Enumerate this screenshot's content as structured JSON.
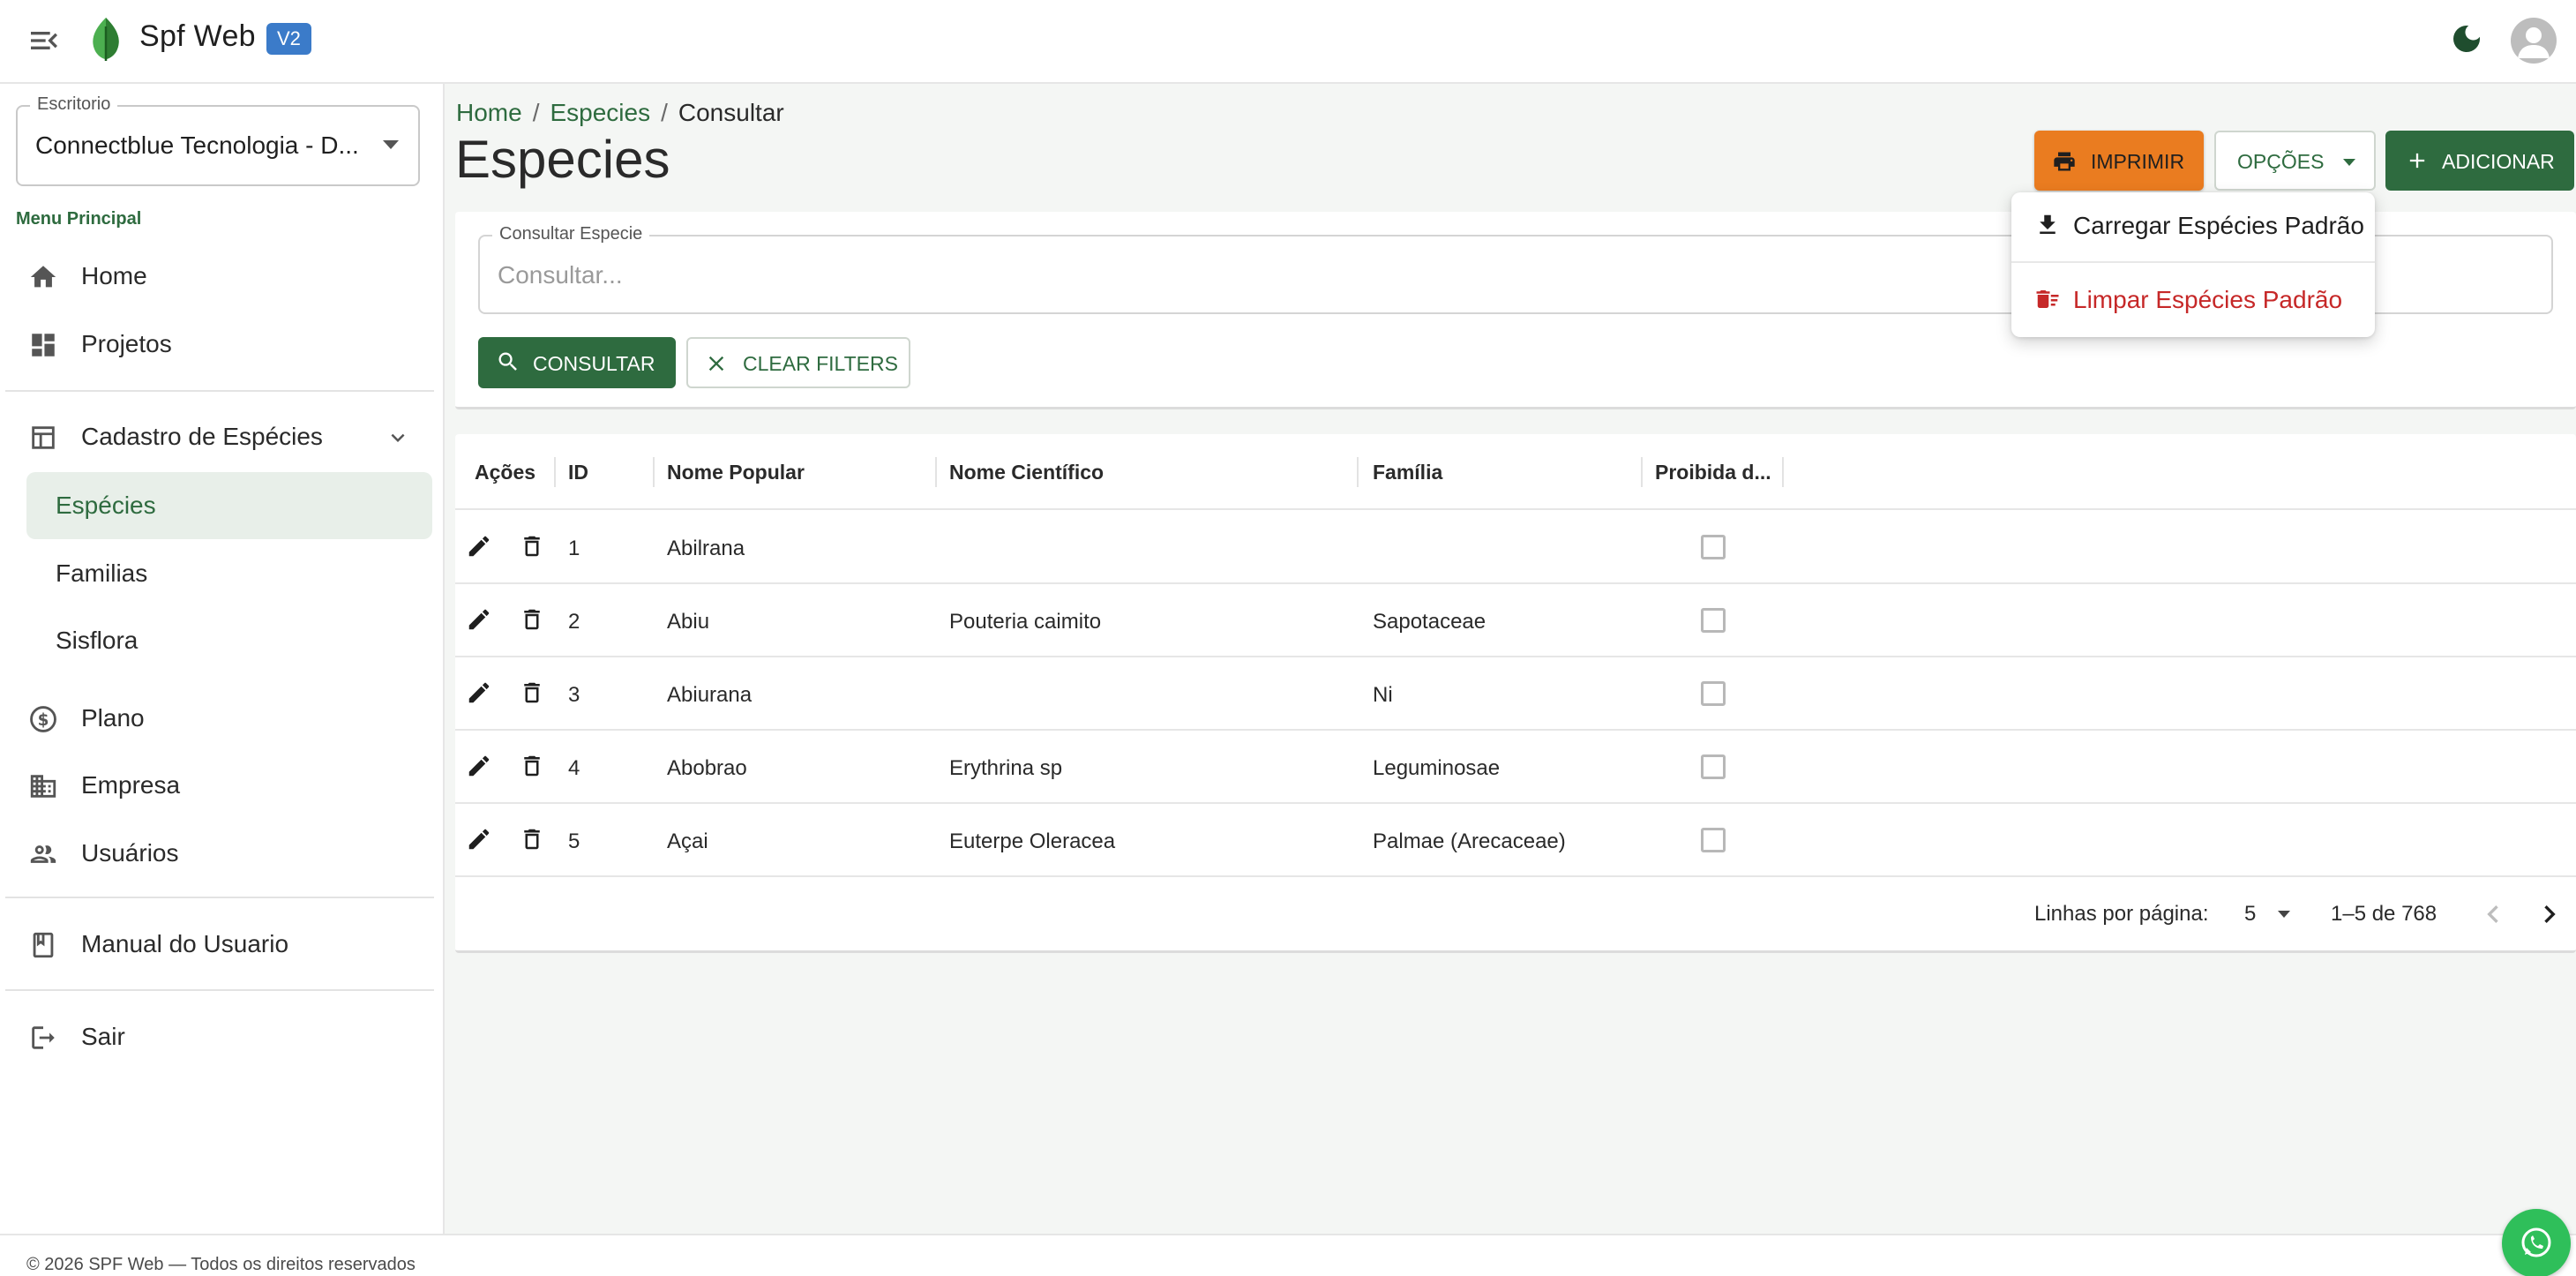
{
  "app": {
    "title": "Spf Web",
    "version": "V2",
    "colors": {
      "primary": "#2e6b3f",
      "accent": "#ea7c20",
      "danger": "#c62828",
      "badge": "#3b7bc9"
    }
  },
  "sidebar": {
    "office": {
      "label": "Escritorio",
      "value": "Connectblue Tecnologia - D..."
    },
    "menu_heading": "Menu Principal",
    "items": {
      "home": "Home",
      "projetos": "Projetos",
      "cadastro": "Cadastro de Espécies",
      "especies": "Espécies",
      "familias": "Familias",
      "sisflora": "Sisflora",
      "plano": "Plano",
      "empresa": "Empresa",
      "usuarios": "Usuários",
      "manual": "Manual do Usuario",
      "sair": "Sair"
    }
  },
  "breadcrumb": {
    "home": "Home",
    "especies": "Especies",
    "current": "Consultar",
    "separator": "/"
  },
  "page": {
    "title": "Especies"
  },
  "actions": {
    "print": "IMPRIMIR",
    "options": "OPÇÕES",
    "add": "ADICIONAR"
  },
  "options_menu": {
    "load_default": "Carregar Espécies Padrão",
    "clear_default": "Limpar Espécies Padrão"
  },
  "filter": {
    "label": "Consultar Especie",
    "placeholder": "Consultar...",
    "value": "",
    "search_button": "CONSULTAR",
    "clear_button": "CLEAR FILTERS"
  },
  "table": {
    "columns": {
      "actions": "Ações",
      "id": "ID",
      "popular": "Nome Popular",
      "scientific": "Nome Científico",
      "family": "Família",
      "forbidden": "Proibida d..."
    },
    "rows": [
      {
        "id": "1",
        "popular": "Abilrana",
        "scientific": "",
        "family": "",
        "forbidden": false
      },
      {
        "id": "2",
        "popular": "Abiu",
        "scientific": "Pouteria caimito",
        "family": "Sapotaceae",
        "forbidden": false
      },
      {
        "id": "3",
        "popular": "Abiurana",
        "scientific": "",
        "family": "Ni",
        "forbidden": false
      },
      {
        "id": "4",
        "popular": "Abobrao",
        "scientific": "Erythrina sp",
        "family": "Leguminosae",
        "forbidden": false
      },
      {
        "id": "5",
        "popular": "Açai",
        "scientific": "Euterpe Oleracea",
        "family": "Palmae (Arecaceae)",
        "forbidden": false
      }
    ],
    "pagination": {
      "rows_label": "Linhas por página:",
      "rows_per_page": "5",
      "range": "1–5 de 768"
    }
  },
  "footer": {
    "text": "© 2026 SPF Web — Todos os direitos reservados"
  },
  "icons": {
    "menu_toggle": "menu-open-icon",
    "logo": "leaf-icon",
    "theme": "moon-icon",
    "avatar": "account-icon",
    "whatsapp": "whatsapp-icon"
  }
}
